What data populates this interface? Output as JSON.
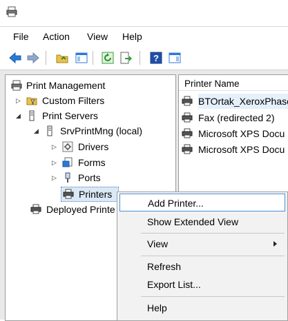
{
  "menu": [
    "File",
    "Action",
    "View",
    "Help"
  ],
  "tree": {
    "root": "Print Management",
    "custom_filters": "Custom Filters",
    "print_servers": "Print Servers",
    "server": "SrvPrintMng (local)",
    "drivers": "Drivers",
    "forms": "Forms",
    "ports": "Ports",
    "printers": "Printers",
    "deployed": "Deployed Printe"
  },
  "list": {
    "header": "Printer Name",
    "rows": [
      "BTOrtak_XeroxPhase",
      "Fax (redirected 2)",
      "Microsoft XPS Docu",
      "Microsoft XPS Docu"
    ]
  },
  "context_menu": {
    "add_printer": "Add Printer...",
    "show_extended": "Show Extended View",
    "view": "View",
    "refresh": "Refresh",
    "export": "Export List...",
    "help": "Help"
  },
  "icons": {
    "app": "print-management-icon",
    "printer": "printer-icon",
    "server": "server-icon",
    "filter": "filter-folder-icon"
  },
  "colors": {
    "accent": "#4a90d9",
    "selection": "#dbe8f6",
    "menu_bg": "#f2f2f2"
  }
}
